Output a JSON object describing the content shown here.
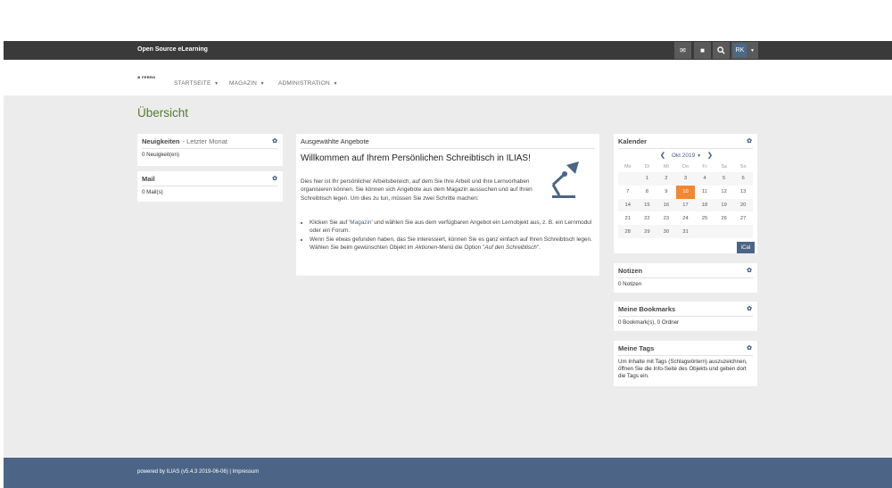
{
  "header": {
    "brand": "Open Source eLearning",
    "user_initials": "RK",
    "icons": [
      "mail-icon",
      "chat-icon",
      "search-icon"
    ]
  },
  "logo_text": "FERRO",
  "nav": [
    {
      "label": "STARTSEITE"
    },
    {
      "label": "MAGAZIN"
    },
    {
      "label": "ADMINISTRATION"
    }
  ],
  "page_title": "Übersicht",
  "news": {
    "title": "Neuigkeiten",
    "subtitle": "- Letzter Monat",
    "body": "0 Neuigkeit(en)"
  },
  "mail": {
    "title": "Mail",
    "body": "0 Mail(s)"
  },
  "featured": {
    "title": "Ausgewählte Angebote",
    "welcome_title": "Willkommen auf Ihrem Persönlichen Schreibtisch in ILIAS!",
    "welcome_text": "Dies hier ist Ihr persönlicher Arbeitsbereich, auf dem Sie Ihre Arbeit und Ihre Lernvorhaben organisieren können. Sie können sich Angebote aus dem Magazin aussuchen und auf Ihren Schreibtisch legen. Um dies zu tun, müssen Sie zwei Schritte machen:",
    "step1_pre": "Klicken Sie auf '",
    "step1_link": "Magazin",
    "step1_post": "' und wählen Sie aus dem verfügbaren Angebot ein Lernobjekt aus, z. B. ein Lernmodul oder ein Forum.",
    "step2_pre": "Wenn Sie etwas gefunden haben, das Sie interessiert, können Sie es ganz einfach auf Ihren Schreibtisch legen. Wählen Sie beim gewünschten Objekt im ",
    "step2_em1": "Aktionen",
    "step2_mid": "-Menü die Option \"",
    "step2_em2": "Auf den Schreibtisch",
    "step2_post": "\"."
  },
  "calendar": {
    "title": "Kalender",
    "month": "Okt 2019",
    "weekdays": [
      "Mo",
      "Di",
      "Mi",
      "Do",
      "Fr",
      "Sa",
      "So"
    ],
    "weeks": [
      [
        "",
        "1",
        "2",
        "3",
        "4",
        "5",
        "6"
      ],
      [
        "7",
        "8",
        "9",
        "10",
        "11",
        "12",
        "13"
      ],
      [
        "14",
        "15",
        "16",
        "17",
        "18",
        "19",
        "20"
      ],
      [
        "21",
        "22",
        "23",
        "24",
        "25",
        "26",
        "27"
      ],
      [
        "28",
        "29",
        "30",
        "31",
        "",
        "",
        ""
      ]
    ],
    "today": "10",
    "ical": "iCal",
    "today_color": "#f58632"
  },
  "notes": {
    "title": "Notizen",
    "body": "0 Notizen"
  },
  "bookmarks": {
    "title": "Meine Bookmarks",
    "body": "0 Bookmark(s), 0 Ordner"
  },
  "tags": {
    "title": "Meine Tags",
    "body": "Um Inhalte mit Tags (Schlagwörtern) auszuzeichnen, öffnen Sie die Info-Seite des Objekts und geben dort die Tags ein."
  },
  "footer": {
    "text": "powered by ILIAS (v5.4.3 2019-06-06) | Impressum"
  },
  "colors": {
    "topbar": "#3a3a3a",
    "accent": "#4c6586",
    "title_green": "#557b2e",
    "footer": "#4c6586"
  }
}
